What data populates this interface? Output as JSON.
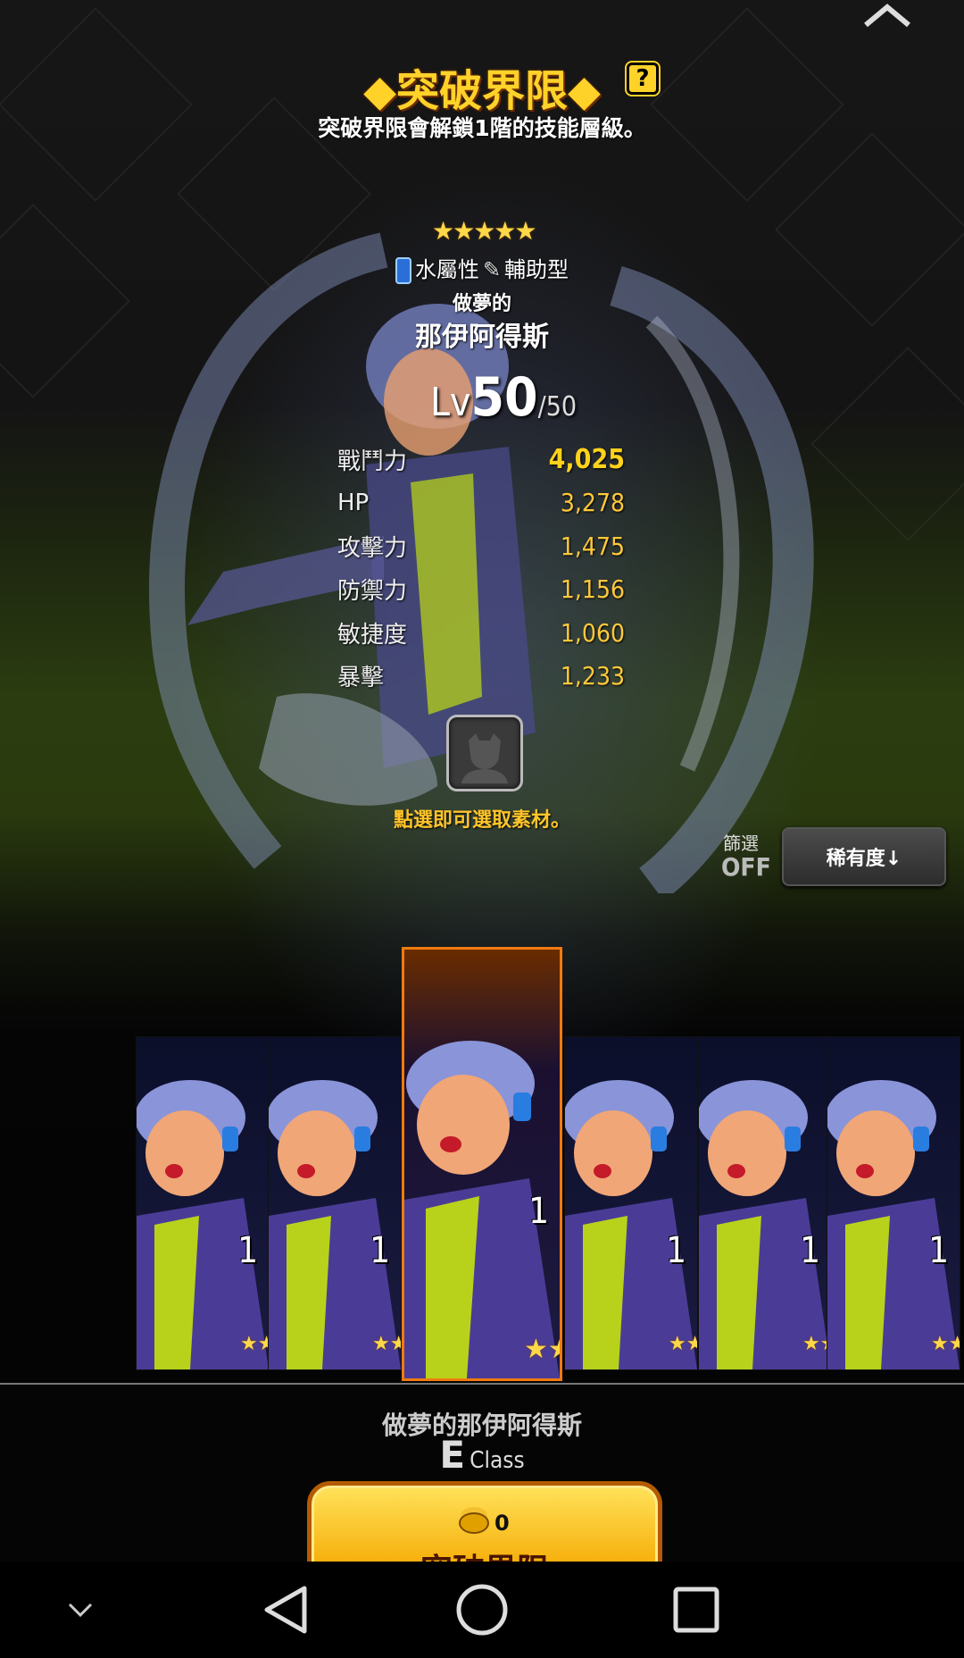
{
  "header": {
    "title": "◆突破界限◆",
    "help_icon": "?",
    "subtitle": "突破界限會解鎖1階的技能層級。"
  },
  "character": {
    "rarity_stars": "★★★★★",
    "attribute": "水屬性",
    "type": "輔助型",
    "epithet": "做夢的",
    "name": "那伊阿得斯",
    "level_prefix": "Lv",
    "level": "50",
    "level_max": "/50",
    "stats": [
      {
        "label": "戰鬥力",
        "value": "4,025"
      },
      {
        "label": "HP",
        "value": "3,278"
      },
      {
        "label": "攻擊力",
        "value": "1,475"
      },
      {
        "label": "防禦力",
        "value": "1,156"
      },
      {
        "label": "敏捷度",
        "value": "1,060"
      },
      {
        "label": "暴擊",
        "value": "1,233"
      }
    ]
  },
  "material": {
    "hint": "點選即可選取素材。"
  },
  "filter": {
    "label": "篩選",
    "state": "OFF",
    "sort_label": "稀有度↓"
  },
  "cards": [
    {
      "count": "1",
      "stars": "★★★★★"
    },
    {
      "count": "1",
      "stars": "★★★★★"
    },
    {
      "count": "1",
      "stars": "★★★★★",
      "selected": true
    },
    {
      "count": "1",
      "stars": "★★★★★"
    },
    {
      "count": "1",
      "stars": "★★★★★"
    },
    {
      "count": "1",
      "stars": "★★★★★"
    }
  ],
  "selection": {
    "name": "做夢的那伊阿得斯",
    "class_letter": "E",
    "class_word": "Class"
  },
  "action": {
    "cost": "0",
    "label": "突破界限"
  },
  "navbar": {
    "icons": [
      "chevron-down-icon",
      "back-icon",
      "home-icon",
      "recents-icon"
    ]
  },
  "colors": {
    "accent_gold": "#ffd22a",
    "stat_value": "#ffc93a",
    "selected_border": "#f07a10",
    "button_yellow": "#f5a800"
  }
}
